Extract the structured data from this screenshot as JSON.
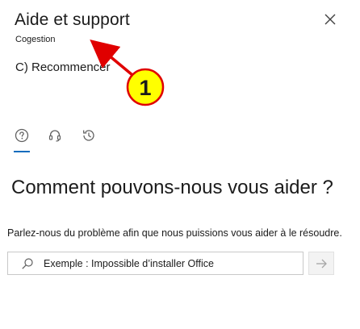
{
  "header": {
    "title": "Aide et support",
    "subtitle": "Cogestion",
    "close_icon": "close-icon"
  },
  "action": {
    "recommencer": "C) Recommencer"
  },
  "annotation": {
    "badge_number": "1",
    "badge_color": "#ffff00",
    "border_color": "#e00000",
    "arrow_color": "#e00000"
  },
  "tabs": [
    {
      "name": "help",
      "icon": "question-circle-icon",
      "active": true
    },
    {
      "name": "contact",
      "icon": "headset-icon",
      "active": false
    },
    {
      "name": "history",
      "icon": "history-icon",
      "active": false
    }
  ],
  "main": {
    "heading": "Comment pouvons-nous vous aider ?",
    "description": "Parlez-nous du problème afin que nous puissions vous aider à le résoudre.",
    "search": {
      "placeholder": "Exemple : Impossible d’installer Office",
      "value": "",
      "icon": "search-icon"
    },
    "submit_icon": "arrow-right-icon"
  },
  "colors": {
    "accent": "#0f6cbd",
    "text": "#1b1b1b",
    "icon_gray": "#616161"
  }
}
